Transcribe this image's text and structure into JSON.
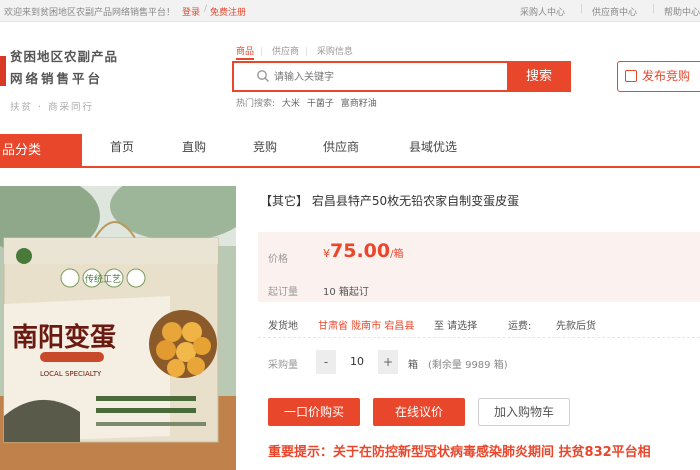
{
  "topbar": {
    "welcome": "欢迎来到贫困地区农副产品网络销售平台！",
    "login": "登录",
    "separator": "/",
    "register": "免费注册",
    "links": [
      "采购人中心",
      "供应商中心",
      "帮助中心"
    ]
  },
  "header": {
    "logo_line1": "贫困地区农副产品",
    "logo_line2": "网络销售平台",
    "logo_slogan": "扶贫 · 商采同行",
    "search_tabs": [
      "商品",
      "供应商",
      "采购信息"
    ],
    "search_placeholder": "请输入关键字",
    "search_button": "搜索",
    "hot_label": "热门搜索:",
    "hot_keywords": [
      "大米",
      "干菌子",
      "富商籽油"
    ],
    "publish_button": "发布竞购"
  },
  "nav": {
    "category": "品分类",
    "items": [
      "首页",
      "直购",
      "竞购",
      "供应商",
      "县域优选"
    ]
  },
  "product": {
    "image_box_text": "南阳变蛋",
    "image_box_sub": "LOCAL SPECIALTY",
    "image_box_tag": "传统工艺",
    "title": "【其它】 宕昌县特产50枚无铅农家自制变蛋皮蛋",
    "price_label": "价格",
    "price_currency": "¥",
    "price_value": "75.00",
    "price_unit": "/箱",
    "moq_label": "起订量",
    "moq_value": "10 箱起订",
    "ship_label": "发货地",
    "ship_location": "甘肃省 陇南市 宕昌县",
    "ship_to": "至 请选择",
    "freight_label": "运费:",
    "freight_value": "先款后货",
    "qty_label": "采购量",
    "qty_minus": "-",
    "qty_value": "10",
    "qty_plus": "+",
    "qty_unit": "箱",
    "stock_text": "(剩余量 9989 箱)",
    "buy_button": "一口价购买",
    "negotiate_button": "在线议价",
    "cart_button": "加入购物车",
    "notice": "重要提示：关于在防控新型冠状病毒感染肺炎期间 扶贫832平台相"
  },
  "colors": {
    "accent": "#e8472c",
    "price_bg": "#fbf1ee"
  }
}
